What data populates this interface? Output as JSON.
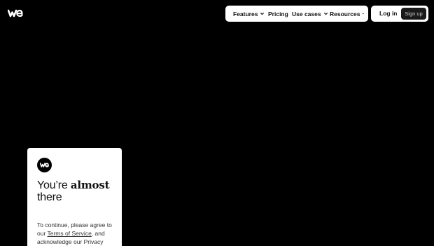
{
  "brand": {
    "logo_icon": "wetransfer-logo-icon"
  },
  "nav": {
    "items": [
      {
        "label": "Features",
        "has_dropdown": true
      },
      {
        "label": "Pricing",
        "has_dropdown": false
      },
      {
        "label": "Use cases",
        "has_dropdown": true
      },
      {
        "label": "Resources",
        "has_dropdown": true
      }
    ]
  },
  "auth": {
    "login_label": "Log in",
    "signup_label": "Sign up"
  },
  "card": {
    "logo_icon": "wetransfer-logo-icon",
    "heading_prefix": "You’re ",
    "heading_emphasis": "almost",
    "heading_suffix": "there",
    "body_prefix": "To continue, please agree to our ",
    "terms_link": "Terms of Service",
    "body_middle": ", and",
    "body_cut": "acknowledge our Privacy"
  },
  "colors": {
    "background": "#000000",
    "surface": "#ffffff",
    "button_dark": "#1a1a1a"
  }
}
